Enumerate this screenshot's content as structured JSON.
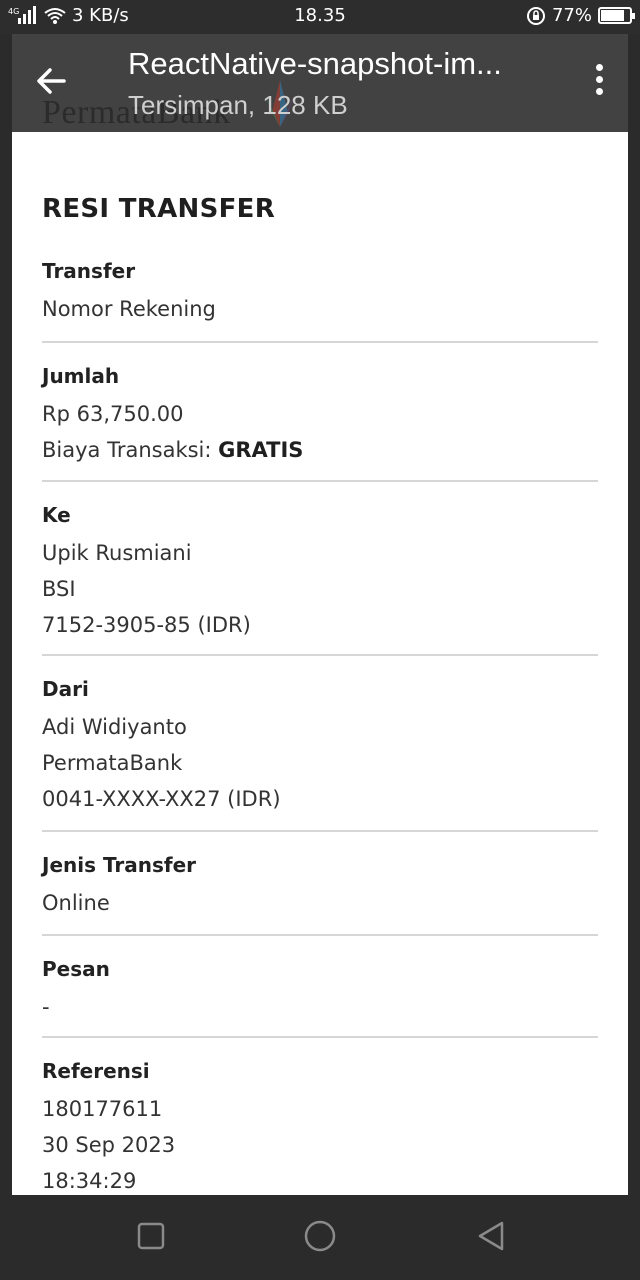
{
  "status_bar": {
    "network_label": "4G",
    "speed": "3 KB/s",
    "time": "18.35",
    "battery": "77%",
    "battery_level": 0.77
  },
  "app_bar": {
    "title": "ReactNative-snapshot-im...",
    "subtitle": "Tersimpan, 128 KB",
    "watermark": "PermataBank"
  },
  "document": {
    "title": "RESI TRANSFER",
    "sections": [
      {
        "label": "Transfer",
        "lines": [
          "Nomor Rekening"
        ]
      },
      {
        "label": "Jumlah",
        "lines": [
          "Rp 63,750.00"
        ],
        "fee_label": "Biaya Transaksi: ",
        "fee_value": "GRATIS"
      },
      {
        "label": "Ke",
        "lines": [
          "Upik Rusmiani",
          "BSI",
          "7152-3905-85 (IDR)"
        ]
      },
      {
        "label": "Dari",
        "lines": [
          "Adi Widiyanto",
          "PermataBank",
          "0041-XXXX-XX27 (IDR)"
        ]
      },
      {
        "label": "Jenis Transfer",
        "lines": [
          "Online"
        ]
      },
      {
        "label": "Pesan",
        "lines": [
          "-"
        ]
      },
      {
        "label": "Referensi",
        "lines": [
          "180177611",
          "30 Sep 2023",
          "18:34:29"
        ]
      }
    ]
  },
  "nav_bar": {
    "icons": [
      "square-recents-icon",
      "circle-home-icon",
      "triangle-back-icon"
    ]
  },
  "colors": {
    "status_bar_bg": "#2d2d2d",
    "app_bar_bg": "#424242",
    "document_bg": "#ffffff",
    "divider": "#d6d6d6"
  }
}
